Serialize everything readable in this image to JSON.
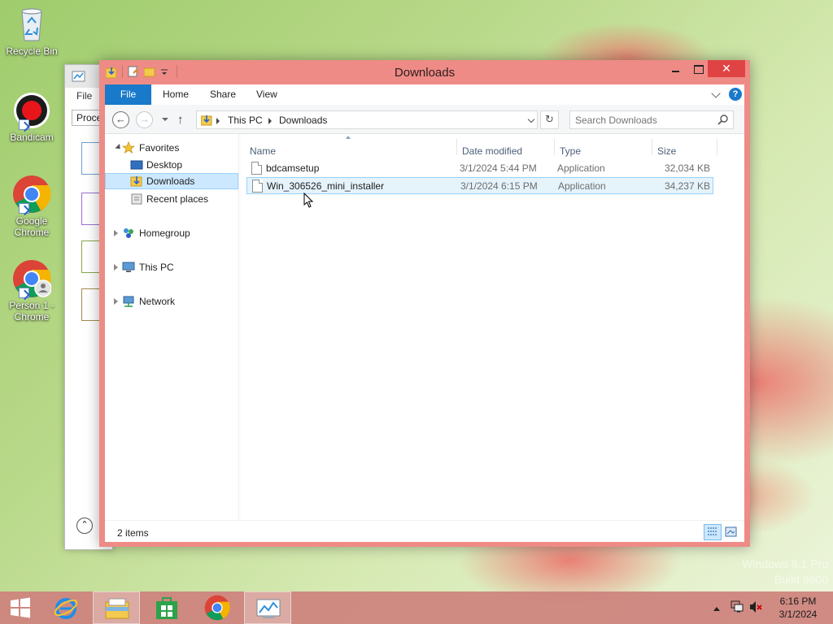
{
  "desktop": {
    "icons": [
      {
        "label": "Recycle Bin",
        "icon": "recycle-bin-icon"
      },
      {
        "label": "Bandicam",
        "icon": "bandicam-icon"
      },
      {
        "label": "Google Chrome",
        "icon": "chrome-icon"
      },
      {
        "label": "Person 1 - Chrome",
        "icon": "chrome-profile-icon"
      }
    ],
    "watermark": {
      "line1": "Windows 8.1 Pro",
      "line2": "Build 9600"
    }
  },
  "background_window": {
    "menu": "File",
    "tab": "Proce"
  },
  "explorer": {
    "title": "Downloads",
    "ribbon_tabs": [
      "File",
      "Home",
      "Share",
      "View"
    ],
    "address": {
      "segments": [
        "This PC",
        "Downloads"
      ]
    },
    "search": {
      "placeholder": "Search Downloads"
    },
    "nav": {
      "favorites": "Favorites",
      "items": [
        "Desktop",
        "Downloads",
        "Recent places"
      ],
      "selected": "Downloads",
      "homegroup": "Homegroup",
      "this_pc": "This PC",
      "network": "Network"
    },
    "columns": [
      "Name",
      "Date modified",
      "Type",
      "Size"
    ],
    "files": [
      {
        "name": "bdcamsetup",
        "date": "3/1/2024 5:44 PM",
        "type": "Application",
        "size": "32,034 KB",
        "selected": false
      },
      {
        "name": "Win_306526_mini_installer",
        "date": "3/1/2024 6:15 PM",
        "type": "Application",
        "size": "34,237 KB",
        "selected": true
      }
    ],
    "status": "2 items",
    "view_mode": "details"
  },
  "taskbar": {
    "pinned": [
      "start-icon",
      "internet-explorer-icon",
      "file-explorer-icon",
      "store-icon",
      "chrome-icon",
      "task-manager-icon"
    ],
    "clock": {
      "time": "6:16 PM",
      "date": "3/1/2024"
    }
  },
  "colors": {
    "window_frame": "#ee8b86",
    "accent": "#1979ca",
    "close_button": "#e04343",
    "selection": "#cce8ff"
  }
}
